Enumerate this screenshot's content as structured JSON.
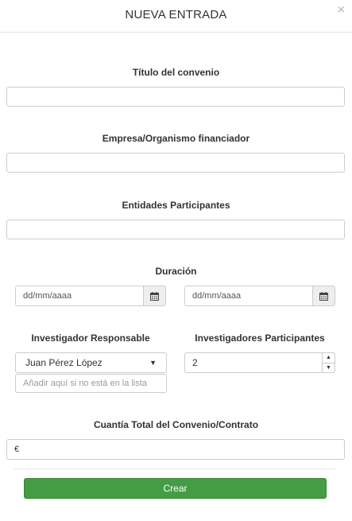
{
  "modal": {
    "title": "NUEVA ENTRADA",
    "close_icon": "×"
  },
  "fields": {
    "titulo": {
      "label": "Título del convenio",
      "value": ""
    },
    "empresa": {
      "label": "Empresa/Organismo financiador",
      "value": ""
    },
    "entidades": {
      "label": "Entidades Participantes",
      "value": ""
    }
  },
  "duracion": {
    "label": "Duración",
    "start_placeholder": "dd/mm/aaaa",
    "end_placeholder": "dd/mm/aaaa",
    "calendar_icon": "calendar-icon"
  },
  "investigador": {
    "label": "Investigador Responsable",
    "selected": "Juan Pérez López",
    "add_placeholder": "Añadir aquí si no está en la lista"
  },
  "participantes": {
    "label": "Investigadores Participantes",
    "value": "2"
  },
  "cuantia": {
    "label": "Cuantía Total del Convenio/Contrato",
    "prefix": "€",
    "value": ""
  },
  "actions": {
    "submit_label": "Crear",
    "submit_color": "#449d44"
  }
}
